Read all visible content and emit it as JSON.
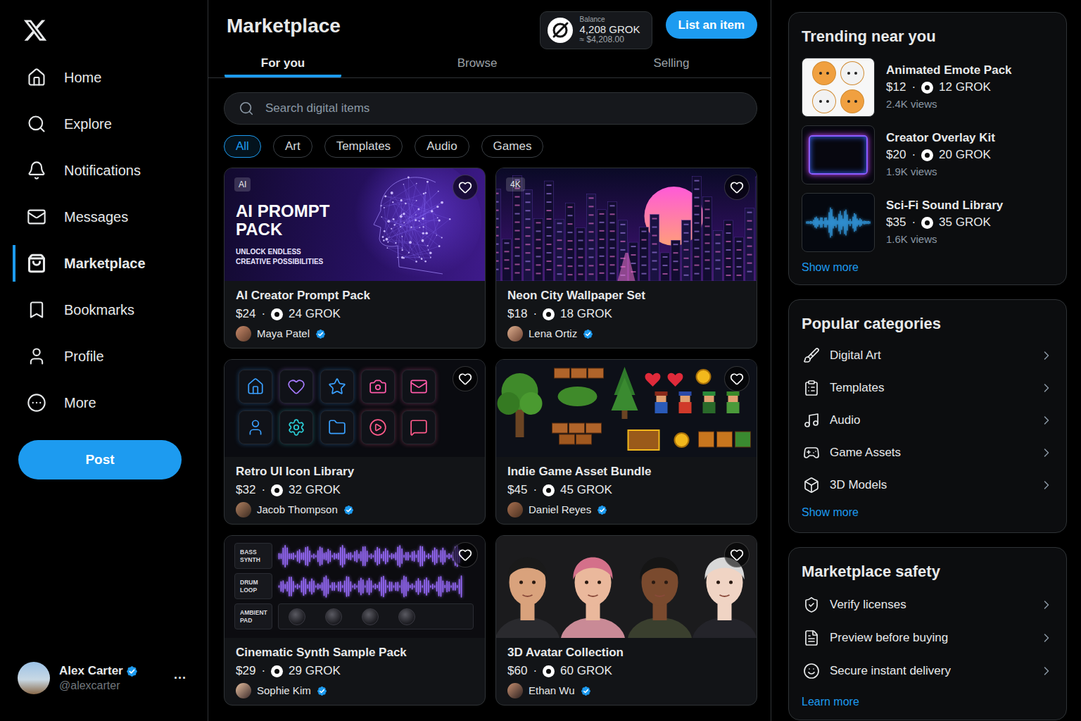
{
  "sidebar": {
    "nav": [
      {
        "label": "Home",
        "selected": false
      },
      {
        "label": "Explore",
        "selected": false
      },
      {
        "label": "Notifications",
        "selected": false
      },
      {
        "label": "Messages",
        "selected": false
      },
      {
        "label": "Marketplace",
        "selected": true
      },
      {
        "label": "Bookmarks",
        "selected": false
      },
      {
        "label": "Profile",
        "selected": false
      },
      {
        "label": "More",
        "selected": false
      }
    ],
    "post_button": "Post",
    "account": {
      "name": "Alex Carter",
      "handle": "@alexcarter",
      "verified": true,
      "menu": "···"
    }
  },
  "header": {
    "title": "Marketplace",
    "balance": {
      "label": "Balance",
      "amount": "4,208 GROK",
      "usd": "≈ $4,208.00"
    },
    "list_button": "List an item"
  },
  "tabs": [
    {
      "label": "For you",
      "selected": true
    },
    {
      "label": "Browse",
      "selected": false
    },
    {
      "label": "Selling",
      "selected": false
    }
  ],
  "search": {
    "placeholder": "Search digital items"
  },
  "filters": [
    {
      "label": "All",
      "selected": true
    },
    {
      "label": "Art",
      "selected": false
    },
    {
      "label": "Templates",
      "selected": false
    },
    {
      "label": "Audio",
      "selected": false
    },
    {
      "label": "Games",
      "selected": false
    }
  ],
  "price_separator": "·",
  "items": [
    {
      "kind": "prompt",
      "badge": "AI",
      "banner_title": [
        "AI PROMPT",
        "PACK"
      ],
      "banner_subtitle": [
        "UNLOCK ENDLESS",
        "CREATIVE POSSIBILITIES"
      ],
      "title": "AI Creator Prompt Pack",
      "price": "$24",
      "grok": "24 GROK",
      "seller": "Maya Patel",
      "verified": true,
      "liked": false
    },
    {
      "kind": "city",
      "badge": "4K",
      "title": "Neon City Wallpaper Set",
      "price": "$18",
      "grok": "18 GROK",
      "seller": "Lena Ortiz",
      "verified": true,
      "liked": false
    },
    {
      "kind": "icons",
      "title": "Retro UI Icon Library",
      "price": "$32",
      "grok": "32 GROK",
      "seller": "Jacob Thompson",
      "verified": true,
      "liked": false
    },
    {
      "kind": "game",
      "title": "Indie Game Asset Bundle",
      "price": "$45",
      "grok": "45 GROK",
      "seller": "Daniel Reyes",
      "verified": true,
      "liked": false
    },
    {
      "kind": "audio",
      "tracks": [
        {
          "label": [
            "BASS",
            "SYNTH"
          ],
          "kind": "wave"
        },
        {
          "label": [
            "DRUM",
            "LOOP"
          ],
          "kind": "wave"
        },
        {
          "label": [
            "AMBIENT",
            "PAD"
          ],
          "kind": "knobs"
        }
      ],
      "title": "Cinematic Synth Sample Pack",
      "price": "$29",
      "grok": "29 GROK",
      "seller": "Sophie Kim",
      "verified": true,
      "liked": false
    },
    {
      "kind": "avatars",
      "title": "3D Avatar Collection",
      "price": "$60",
      "grok": "60 GROK",
      "seller": "Ethan Wu",
      "verified": true,
      "liked": false
    }
  ],
  "trending": {
    "title": "Trending near you",
    "items": [
      {
        "kind": "emotes",
        "title": "Animated Emote Pack",
        "price": "$12",
        "grok": "12 GROK",
        "views": "2.4K views"
      },
      {
        "kind": "overlay",
        "title": "Creator Overlay Kit",
        "price": "$20",
        "grok": "20 GROK",
        "views": "1.9K views"
      },
      {
        "kind": "wave",
        "title": "Sci-Fi Sound Library",
        "price": "$35",
        "grok": "35 GROK",
        "views": "1.6K views"
      }
    ],
    "more": "Show more"
  },
  "categories": {
    "title": "Popular categories",
    "items": [
      "Digital Art",
      "Templates",
      "Audio",
      "Game Assets",
      "3D Models"
    ],
    "more": "Show more"
  },
  "safety": {
    "title": "Marketplace safety",
    "items": [
      "Verify licenses",
      "Preview before buying",
      "Secure instant delivery"
    ],
    "more": "Learn more"
  }
}
